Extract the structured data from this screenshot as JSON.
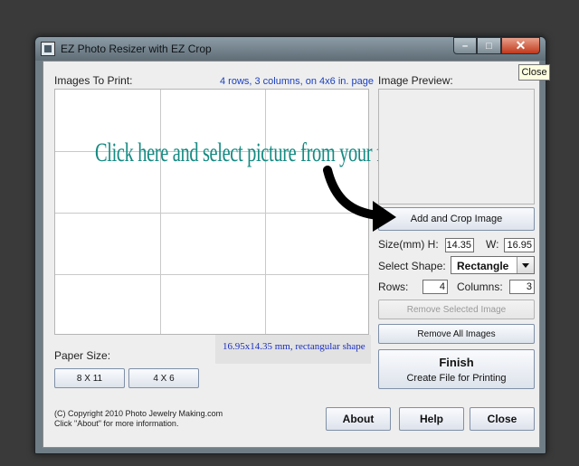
{
  "window": {
    "title": "EZ Photo Resizer with EZ Crop",
    "tooltip": "Close"
  },
  "left_panel": {
    "images_label": "Images To Print:",
    "grid_info": "4 rows, 3 columns, on 4x6 in. page",
    "prompt": "Click here and select picture from your files",
    "paper_size_label": "Paper Size:",
    "paper_sizes": [
      "8 X 11",
      "4 X 6"
    ],
    "shape_info": "16.95x14.35 mm, rectangular shape"
  },
  "right_panel": {
    "preview_label": "Image Preview:",
    "add_crop_label": "Add and Crop Image",
    "size_label": "Size(mm) H:",
    "height_value": "14.35",
    "width_label": "W:",
    "width_value": "16.95",
    "shape_label": "Select Shape:",
    "shape_value": "Rectangle",
    "rows_label": "Rows:",
    "rows_value": "4",
    "columns_label": "Columns:",
    "columns_value": "3",
    "remove_selected_label": "Remove Selected Image",
    "remove_all_label": "Remove All Images",
    "finish_title": "Finish",
    "finish_subtitle": "Create File for Printing"
  },
  "footer": {
    "copyright_line1": "(C) Copyright 2010 Photo Jewelry Making.com",
    "copyright_line2": "Click \"About\" for more information.",
    "about_label": "About",
    "help_label": "Help",
    "close_label": "Close"
  },
  "grid": {
    "rows": 4,
    "columns": 3
  },
  "colors": {
    "prompt": "#148a82",
    "info_text": "#1a3fbf",
    "arrow": "#000000"
  },
  "icons": {
    "annotation_arrow": "curved-arrow-icon"
  }
}
